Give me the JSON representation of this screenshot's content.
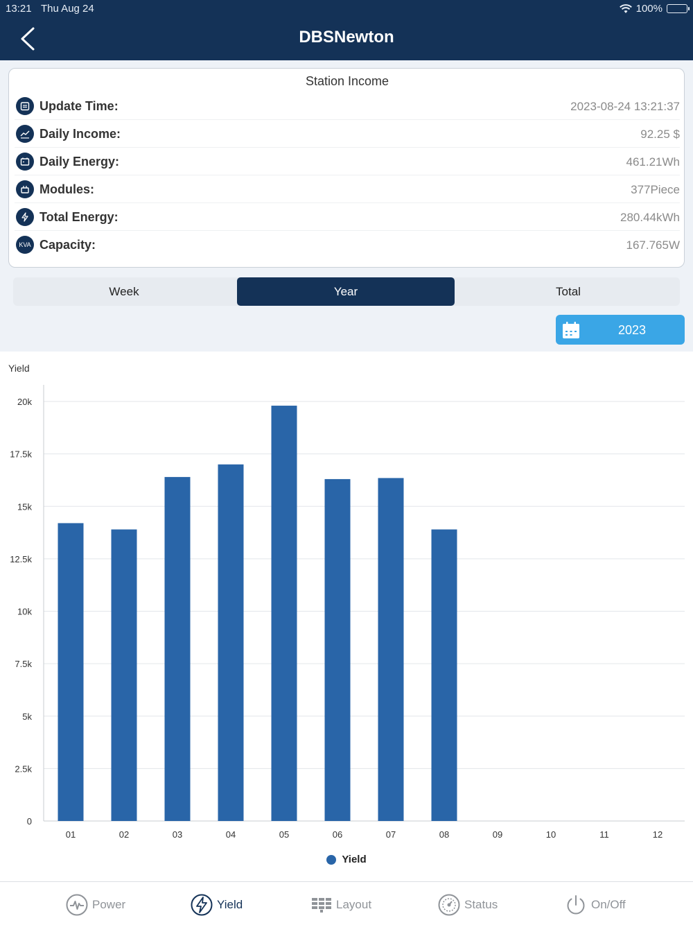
{
  "status_bar": {
    "time": "13:21",
    "date": "Thu Aug 24",
    "battery": "100%"
  },
  "header": {
    "title": "DBSNewton",
    "back_icon": "chevron-left-icon"
  },
  "income": {
    "title": "Station Income",
    "rows": [
      {
        "label": "Update Time:",
        "value": "2023-08-24 13:21:37",
        "icon": "calendar-icon"
      },
      {
        "label": "Daily Income:",
        "value": "92.25 $",
        "icon": "chart-icon"
      },
      {
        "label": "Daily Energy:",
        "value": "461.21Wh",
        "icon": "battery-icon"
      },
      {
        "label": "Modules:",
        "value": "377Piece",
        "icon": "module-icon"
      },
      {
        "label": "Total Energy:",
        "value": "280.44kWh",
        "icon": "bolt-icon"
      },
      {
        "label": "Capacity:",
        "value": "167.765W",
        "icon": "kva-icon",
        "icon_text": "KVA"
      }
    ]
  },
  "segments": {
    "week": "Week",
    "year": "Year",
    "total": "Total",
    "active": "Year"
  },
  "year_picker": {
    "value": "2023",
    "icon": "calendar-icon"
  },
  "chart_data": {
    "type": "bar",
    "ylabel": "Yield",
    "ylim": [
      0,
      20000
    ],
    "yticks": [
      "0",
      "2.5k",
      "5k",
      "7.5k",
      "10k",
      "12.5k",
      "15k",
      "17.5k",
      "20k"
    ],
    "categories": [
      "01",
      "02",
      "03",
      "04",
      "05",
      "06",
      "07",
      "08",
      "09",
      "10",
      "11",
      "12"
    ],
    "series": [
      {
        "name": "Yield",
        "color": "#2965a8",
        "values": [
          14200,
          13900,
          16400,
          17000,
          19800,
          16300,
          16350,
          13900,
          0,
          0,
          0,
          0
        ]
      }
    ],
    "grid": true,
    "legend": "bottom-center"
  },
  "tabs": [
    {
      "label": "Power",
      "icon": "pulse-icon"
    },
    {
      "label": "Yield",
      "icon": "bolt-circle-icon",
      "active": true
    },
    {
      "label": "Layout",
      "icon": "panel-grid-icon"
    },
    {
      "label": "Status",
      "icon": "gauge-icon"
    },
    {
      "label": "On/Off",
      "icon": "power-icon"
    }
  ]
}
